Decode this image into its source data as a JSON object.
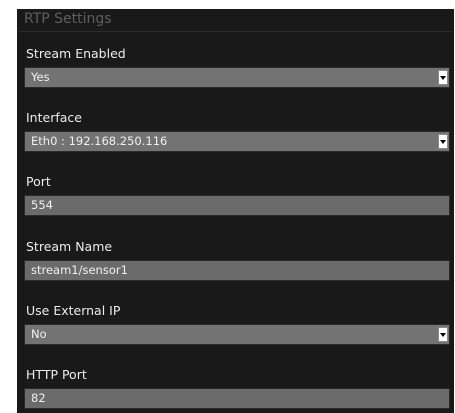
{
  "panel": {
    "title": "RTP Settings"
  },
  "fields": {
    "stream_enabled": {
      "label": "Stream Enabled",
      "value": "Yes"
    },
    "interface": {
      "label": "Interface",
      "value": "Eth0 : 192.168.250.116"
    },
    "port": {
      "label": "Port",
      "value": "554"
    },
    "stream_name": {
      "label": "Stream Name",
      "value": "stream1/sensor1"
    },
    "use_external_ip": {
      "label": "Use External IP",
      "value": "No"
    },
    "http_port": {
      "label": "HTTP Port",
      "value": "82"
    }
  },
  "icons": {
    "dropdown": "chevron-down-icon"
  },
  "colors": {
    "panel_background": "#191919",
    "field_background": "#6b6b6b",
    "title_text": "#5e5e5e",
    "label_text": "#ececec"
  }
}
